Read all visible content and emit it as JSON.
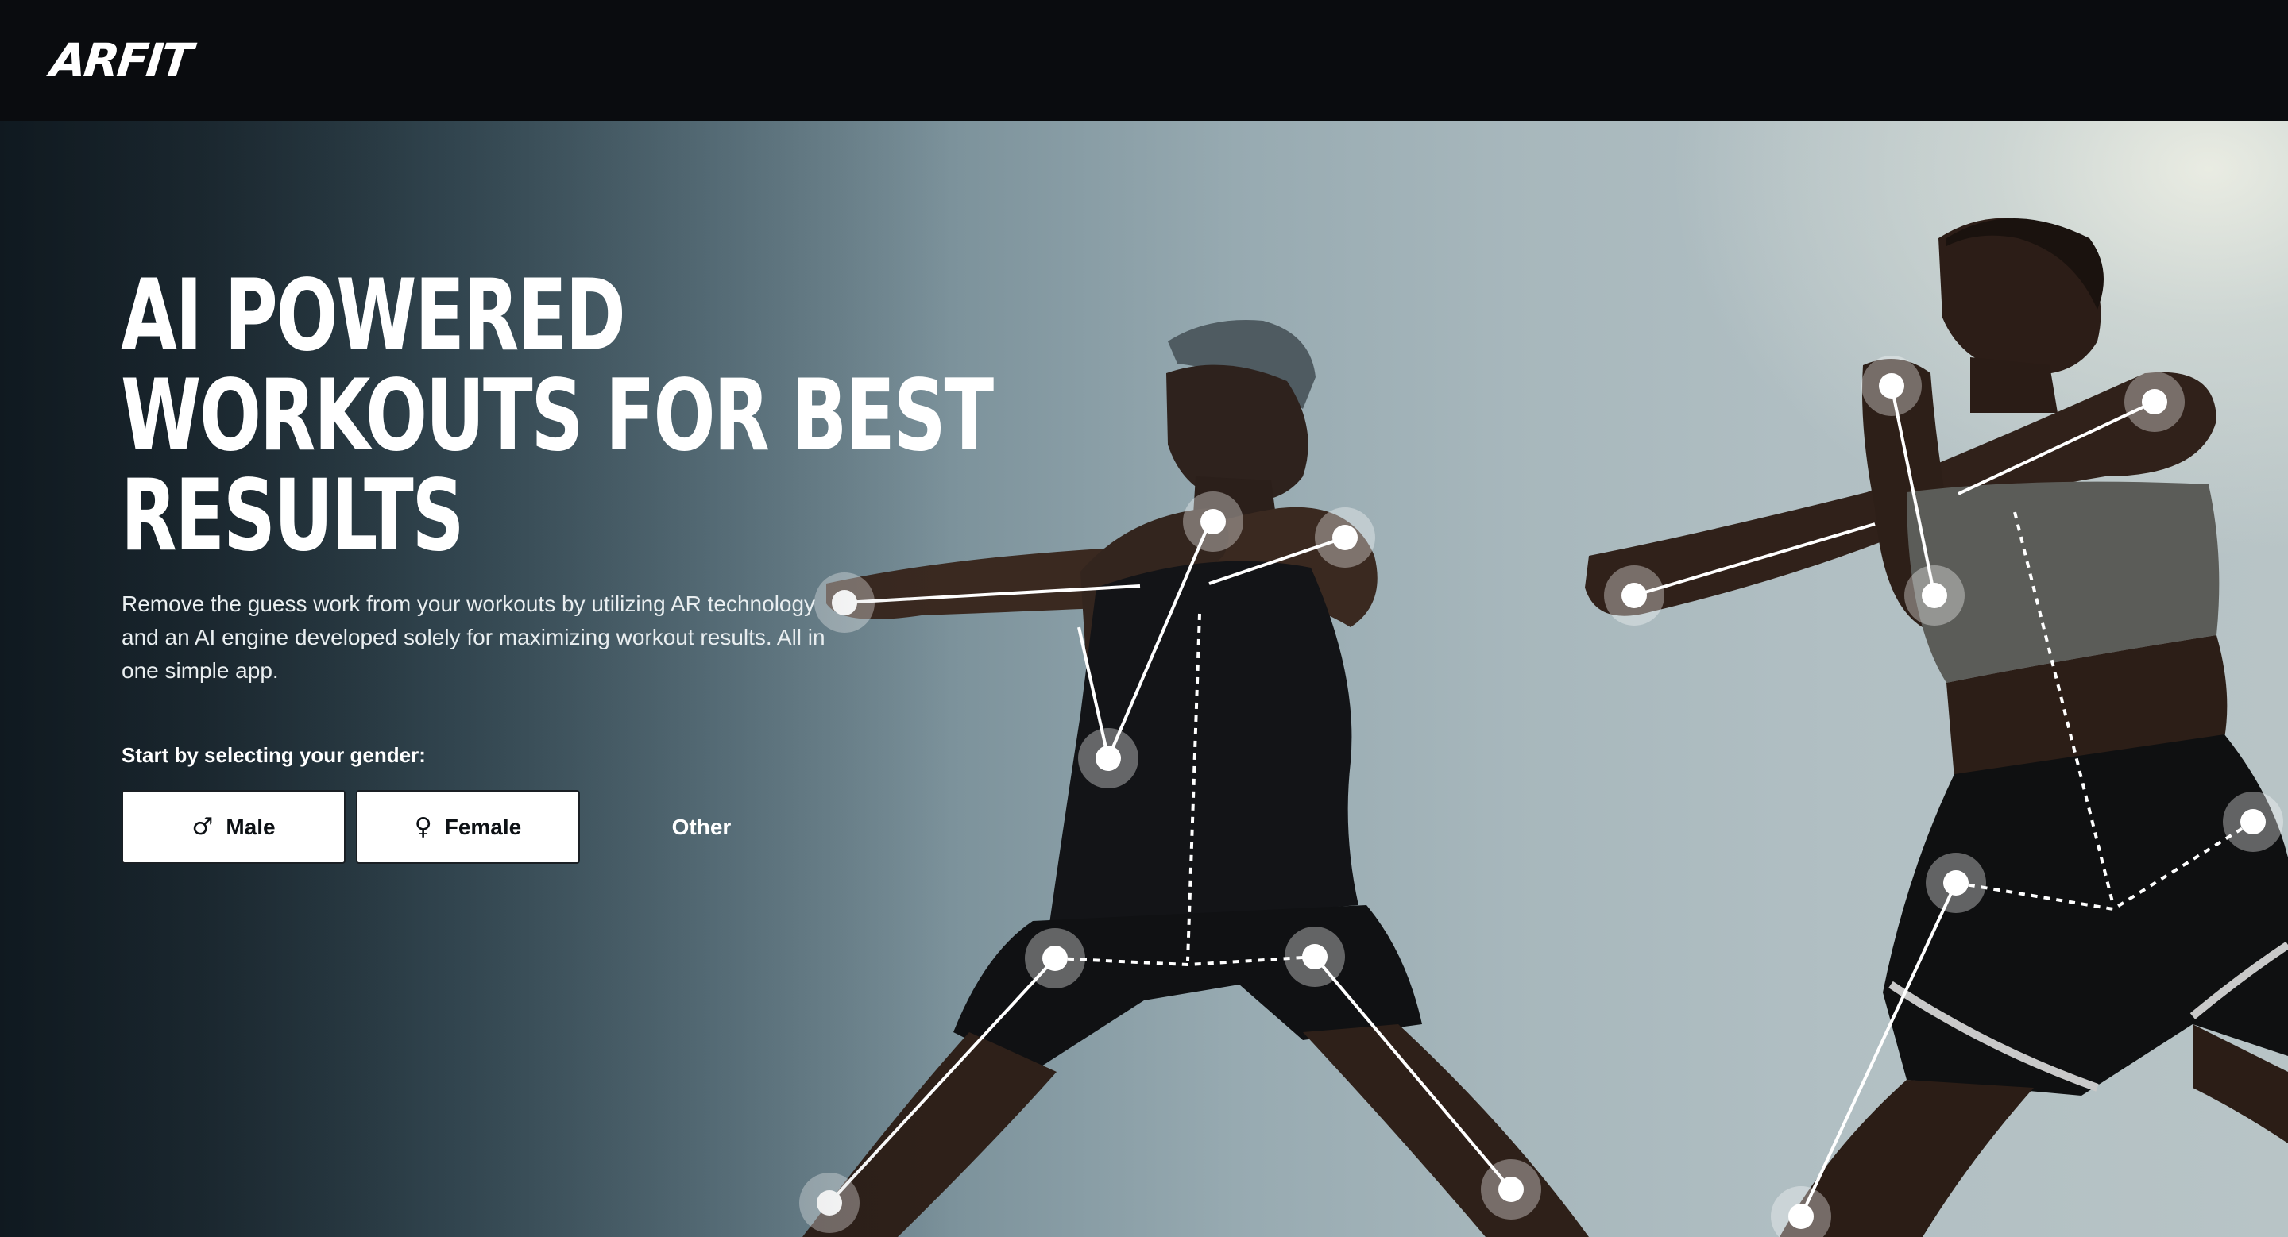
{
  "header": {
    "logo_text": "ARFIT"
  },
  "hero": {
    "headline_lines": [
      "AI POWERED",
      "WORKOUTS FOR BEST",
      "RESULTS"
    ],
    "description": "Remove the guess work from your workouts by utilizing AR technology and an AI engine developed solely for maximizing workout results. All in one simple app.",
    "gender_prompt": "Start by selecting your gender:",
    "gender_options": [
      {
        "label": "Male",
        "icon": "male-symbol-icon",
        "glyph": "♂"
      },
      {
        "label": "Female",
        "icon": "female-symbol-icon",
        "glyph": "♀"
      },
      {
        "label": "Other"
      }
    ],
    "background_image": "two athletes stretching arms with AR pose-tracking skeleton overlay"
  },
  "colors": {
    "header_bg": "#0a0c0f",
    "text_primary": "#ffffff",
    "button_bg": "#ffffff",
    "button_text": "#0d1115",
    "overlay_joint": "#ffffff"
  }
}
